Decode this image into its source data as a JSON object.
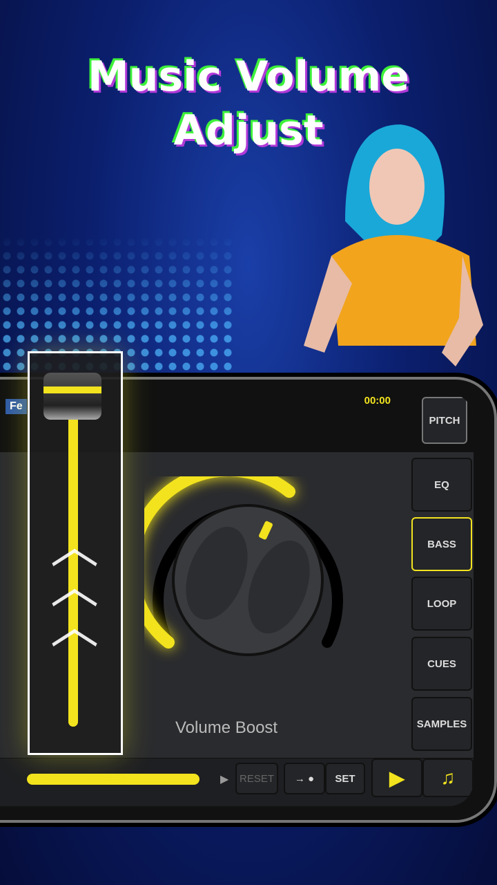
{
  "headline": {
    "line1": "Music Volume",
    "line2": "Adjust"
  },
  "player": {
    "time": "00:00",
    "side_buttons": [
      {
        "label": "PITCH"
      },
      {
        "label": "EQ"
      },
      {
        "label": "BASS",
        "active": true
      },
      {
        "label": "LOOP"
      },
      {
        "label": "CUES"
      },
      {
        "label": "SAMPLES"
      }
    ],
    "knob_label": "Volume Boost",
    "bottom": {
      "reset": "RESET",
      "set": "SET",
      "play_icon": "play-icon",
      "add_music_icon": "add-music-icon"
    },
    "deck_tag": "Fe"
  },
  "colors": {
    "accent": "#f2e31e",
    "background": "#0b1f6e"
  }
}
